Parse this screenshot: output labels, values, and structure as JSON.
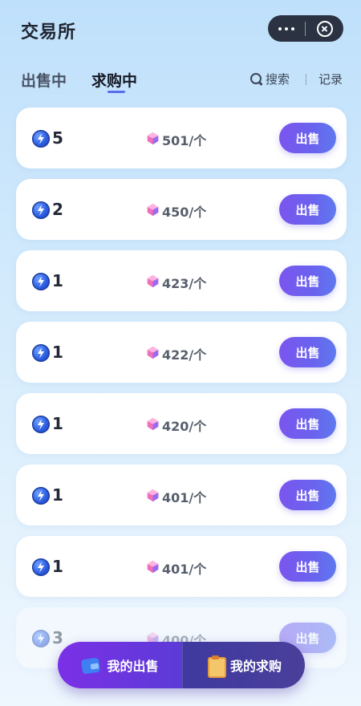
{
  "header": {
    "title": "交易所",
    "more_icon": "more-dots-icon",
    "close_icon": "close-circle-icon"
  },
  "tabs": {
    "sell_label": "出售中",
    "buy_label": "求购中",
    "active": "buy",
    "accent_color": "#5a6cf0"
  },
  "toolbar": {
    "search_label": "搜索",
    "search_icon": "search-icon",
    "records_label": "记录"
  },
  "orders": [
    {
      "qty": "5",
      "price": "501/个",
      "action": "出售"
    },
    {
      "qty": "2",
      "price": "450/个",
      "action": "出售"
    },
    {
      "qty": "1",
      "price": "423/个",
      "action": "出售"
    },
    {
      "qty": "1",
      "price": "422/个",
      "action": "出售"
    },
    {
      "qty": "1",
      "price": "420/个",
      "action": "出售"
    },
    {
      "qty": "1",
      "price": "401/个",
      "action": "出售"
    },
    {
      "qty": "1",
      "price": "401/个",
      "action": "出售"
    },
    {
      "qty": "3",
      "price": "400/个",
      "action": "出售"
    }
  ],
  "bottom_bar": {
    "my_sales_label": "我的出售",
    "my_requests_label": "我的求购",
    "my_sales_icon": "wallet-icon",
    "my_requests_icon": "clipboard-icon"
  },
  "colors": {
    "button_gradient_start": "#7b55ee",
    "button_gradient_end": "#5f79ef",
    "background": "#d2eafc"
  }
}
